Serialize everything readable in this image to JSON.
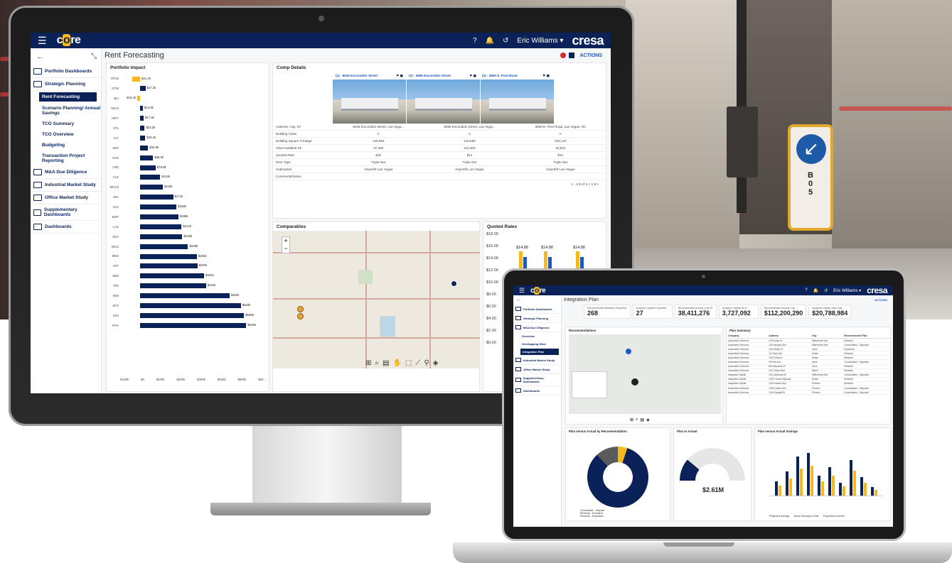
{
  "monitor": {
    "topbar": {
      "logo": "core",
      "user": "Eric Williams ▾",
      "brand": "cresa"
    },
    "page_title": "Rent Forecasting",
    "actions_label": "ACTIONS",
    "sidebar": [
      {
        "label": "Portfolio Dashboards",
        "type": "group"
      },
      {
        "label": "Strategic Planning",
        "type": "group"
      },
      {
        "label": "Rent Forecasting",
        "type": "active"
      },
      {
        "label": "Scenario Planning/ Annual Savings",
        "type": "sub"
      },
      {
        "label": "TCO Summary",
        "type": "sub"
      },
      {
        "label": "TCO Overview",
        "type": "sub"
      },
      {
        "label": "Budgeting",
        "type": "sub"
      },
      {
        "label": "Transaction Project Reporting",
        "type": "sub"
      },
      {
        "label": "M&A Due Diligence",
        "type": "group"
      },
      {
        "label": "Industrial Market Study",
        "type": "group"
      },
      {
        "label": "Office Market Study",
        "type": "group"
      },
      {
        "label": "Supplementary Dashboards",
        "type": "group"
      },
      {
        "label": "Dashboards",
        "type": "group"
      }
    ],
    "portfolio_impact": {
      "title": "Portfolio Impact",
      "x_ticks": [
        "-$100k",
        "$0",
        "$100k",
        "$200k",
        "$300k",
        "$400k",
        "$500k",
        "$60..."
      ]
    },
    "comp_details": {
      "title": "Comp Details",
      "columns": [
        "(1) - 6635 Escondido Street",
        "(2) - 6585 Escondido Street",
        "(3) - 3650 E. Post Road"
      ],
      "rows": [
        {
          "label": "Address, City, ST",
          "values": [
            "6635 Escondido Street, Las Vega...",
            "6585 Escondido Street, Las Vega...",
            "3650 E. Post Road, Las Vegas, NV"
          ]
        },
        {
          "label": "Building Class",
          "values": [
            "A",
            "A",
            "A"
          ]
        },
        {
          "label": "Building Square Footage",
          "values": [
            "145,594",
            "145,598",
            "158,124"
          ]
        },
        {
          "label": "Total Available SF",
          "values": [
            "37,000",
            "112,000",
            "33,642"
          ]
        },
        {
          "label": "Quoted Rate",
          "values": [
            "$15",
            "$14",
            "$14"
          ]
        },
        {
          "label": "Rent Type",
          "values": [
            "Triple Net",
            "Triple Net",
            "Triple Net"
          ]
        },
        {
          "label": "Submarket",
          "values": [
            "Airport/E Las Vegas",
            "Airport/E Las Vegas",
            "Airport/E Las Vegas"
          ]
        },
        {
          "label": "Comments/Notes",
          "values": [
            "",
            "",
            ""
          ]
        }
      ],
      "pager": "1 - 3 ▾ of 3   <   1 ▾   >"
    },
    "comparables": {
      "title": "Comparables",
      "zoom_in": "+",
      "zoom_out": "−",
      "streets": [
        "E Russell Rd",
        "E Patrick Ln",
        "Sunset Park",
        "Wynn Rd",
        "Spencer St",
        "Eastern Ave"
      ]
    },
    "quoted_rates": {
      "title": "Quoted Rates",
      "y_ticks": [
        "$18.00",
        "$16.00",
        "$14.00",
        "$12.00",
        "$10.00",
        "$8.00",
        "$6.00",
        "$4.00",
        "$2.00",
        "$0.00"
      ]
    }
  },
  "chart_data": [
    {
      "type": "bar",
      "title": "Portfolio Impact",
      "orientation": "horizontal",
      "categories": [
        "SFO2",
        "DTW",
        "MLI",
        "SEA3",
        "MGY",
        "STL",
        "ICT",
        "SDF",
        "CHS",
        "LRD",
        "CLE",
        "MCO2",
        "MIA",
        "SAV",
        "MSP",
        "LAS",
        "SEA",
        "MCO",
        "MKE",
        "JOT",
        "SBN",
        "TPA",
        "BWI",
        "SFO",
        "MCI",
        "PHX"
      ],
      "values": [
        -41.1,
        27.2,
        -15.1,
        13.9,
        17.3,
        23.3,
        26.4,
        40.9,
        66.5,
        79.8,
        104,
        118,
        171,
        188,
        198,
        214,
        218,
        248,
        294,
        297,
        331,
        341,
        463,
        522,
        538,
        549
      ],
      "value_labels": [
        "$41.1k",
        "$27.2k",
        "-$15.1k",
        "$13.9k",
        "$17.3k",
        "$23.3k",
        "$26.4k",
        "$40.9k",
        "$66.5k",
        "$79.8k",
        "$104k",
        "$118k",
        "$171k",
        "$188k",
        "$198k",
        "$214k",
        "$218k",
        "$248k",
        "$294k",
        "$297k",
        "$331k",
        "$341k",
        "$463k",
        "$522k",
        "$538k",
        "$549k"
      ],
      "xlim": [
        -100,
        600
      ]
    },
    {
      "type": "bar",
      "title": "Quoted Rates",
      "categories": [
        "(1)",
        "(2)",
        "(3)"
      ],
      "series": [],
      "values": [
        14.88,
        14.88,
        14.88
      ],
      "value_labels": [
        "$14.88",
        "$14.88",
        "$14.88"
      ],
      "ylim": [
        0,
        18
      ]
    }
  ],
  "laptop": {
    "page_title": "Integration Plan",
    "actions_label": "ACTIONS",
    "kpis": [
      {
        "label": "Recommended Retained Properties",
        "value": "268"
      },
      {
        "label": "Acquired Capital Properties",
        "value": "27"
      },
      {
        "label": "Recommended Annual Cost SF",
        "value": "38,411,276"
      },
      {
        "label": "Acquired Capital Sq Ft",
        "value": "3,727,092"
      },
      {
        "label": "Recommended Annual Cost",
        "value": "$112,200,290"
      },
      {
        "label": "Acquired Capital Total Cost",
        "value": "$20,788,984"
      }
    ],
    "sidebar": [
      {
        "label": "Portfolio Dashboards",
        "type": "group"
      },
      {
        "label": "Strategic Planning",
        "type": "group"
      },
      {
        "label": "M&A Due Diligence",
        "type": "group"
      },
      {
        "label": "Overview",
        "type": "sub"
      },
      {
        "label": "Overlapping Sites",
        "type": "sub"
      },
      {
        "label": "Integration Plan",
        "type": "active"
      },
      {
        "label": "Industrial Market Study",
        "type": "group"
      },
      {
        "label": "Office Market Study",
        "type": "group"
      },
      {
        "label": "Supplementary Dashboards",
        "type": "group"
      },
      {
        "label": "Dashboards",
        "type": "group"
      }
    ],
    "recommendations_title": "Recommendations",
    "plan_summary": {
      "title": "Plan Summary",
      "headers": [
        "Company",
        "Address",
        "City",
        "Recommended Plan"
      ],
      "rows": [
        [
          "Assembled Ventures",
          "2100 Main St.",
          "Wilberforce Ave",
          "Retained"
        ],
        [
          "Assembled Ventures",
          "100 Newport Ave",
          "Wilberforce Ave",
          "Consolidated - Disposed"
        ],
        [
          "Assembled Ventures",
          "100 Infinity Ct",
          "Irvine",
          "Expanded"
        ],
        [
          "Assembled Ventures",
          "111 Starr Ave",
          "Dallas",
          "Retained"
        ],
        [
          "Assembled Ventures",
          "1575 Vista Dr",
          "Dallas",
          "Retained"
        ],
        [
          "Assembled Ventures",
          "500 5th Ave",
          "Irvine",
          "Consolidated - Disposed"
        ],
        [
          "Assembled Ventures",
          "800 Bay Area Dr",
          "Irvine",
          "Retained"
        ],
        [
          "Assembled Ventures",
          "201 Ocean Blvd",
          "Miami",
          "Retained"
        ],
        [
          "Integrated Capital",
          "100 Lakewood Dr",
          "Wilberforce Ave",
          "Consolidated - Disposed"
        ],
        [
          "Integrated Capital",
          "2200 Lincoln Highway",
          "Dallas",
          "Retained"
        ],
        [
          "Integrated Capital",
          "1200 Nordic Hwy",
          "Phoenix",
          "Retained"
        ],
        [
          "Assembled Ventures",
          "1250 Golden Ave",
          "Phoenix",
          "Consolidated - Disposed"
        ],
        [
          "Assembled Ventures",
          "1200 Rangell Dr",
          "Phoenix",
          "Consolidated - Disposed"
        ]
      ]
    },
    "plan_vs_actual_title": "Plan versus Actual by Recommendation",
    "plan_to_actual_title": "Plan to Actual",
    "plan_to_actual_value": "$2.61M",
    "plan_vs_actual_savings_title": "Plan versus Actual Savings",
    "donut_legend": [
      "Consolidate - Dispose",
      "Renewal - Downsize",
      "Renewal - Expansion"
    ],
    "savings_legend": [
      "Projected Savings",
      "Actual Savings to Date",
      "Properties Involved"
    ]
  }
}
